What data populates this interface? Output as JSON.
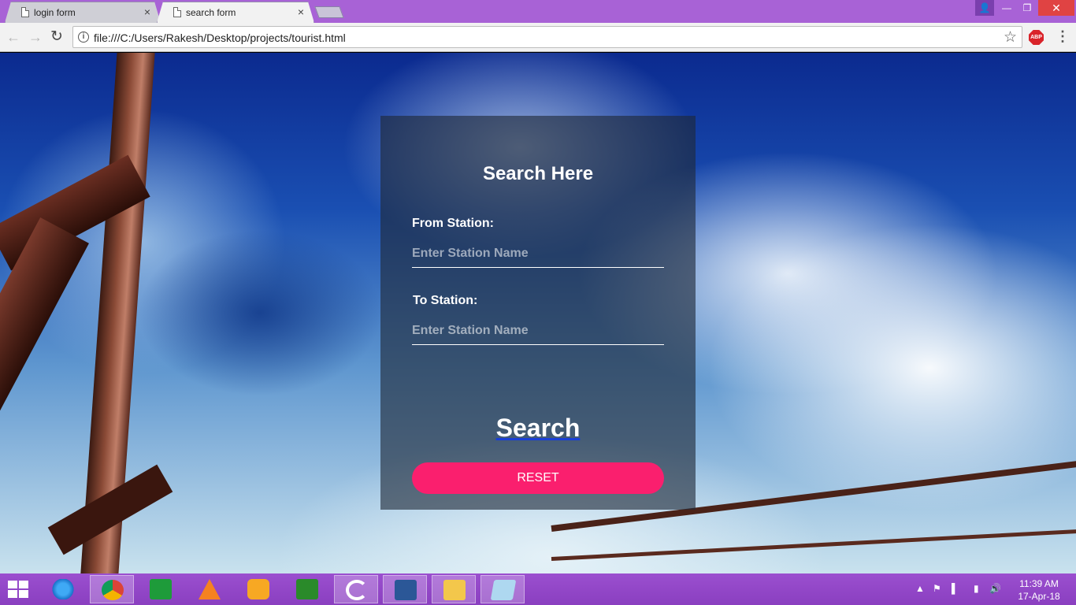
{
  "browser": {
    "tabs": [
      {
        "title": "login form",
        "close": "×"
      },
      {
        "title": "search form",
        "close": "×"
      }
    ],
    "url": "file:///C:/Users/Rakesh/Desktop/projects/tourist.html",
    "abp_label": "ABP",
    "controls": {
      "minimize": "—",
      "maximize": "❐",
      "close": "✕",
      "user": "👤"
    },
    "icons": {
      "back": "arrow-left",
      "forward": "arrow-right",
      "reload": "reload",
      "info": "info",
      "star": "star",
      "menu": "kebab-menu"
    }
  },
  "form": {
    "title": "Search Here",
    "from_label": "From Station:",
    "from_placeholder": "Enter Station Name",
    "to_label": "To Station:",
    "to_placeholder": "Enter Station Name",
    "search_label": "Search",
    "reset_label": "RESET",
    "colors": {
      "reset_bg": "#fa1f6e",
      "card_bg": "rgba(30,40,55,0.62)",
      "search_underline": "#1a3fd6"
    }
  },
  "taskbar": {
    "apps": [
      "windows-start",
      "internet-explorer",
      "chrome",
      "windows-store",
      "vlc",
      "media-player",
      "stock-chart-app",
      "cyberlink-app",
      "microsoft-word",
      "file-explorer",
      "notepad"
    ],
    "active_app": "chrome",
    "time": "11:39 AM",
    "date": "17-Apr-18"
  }
}
